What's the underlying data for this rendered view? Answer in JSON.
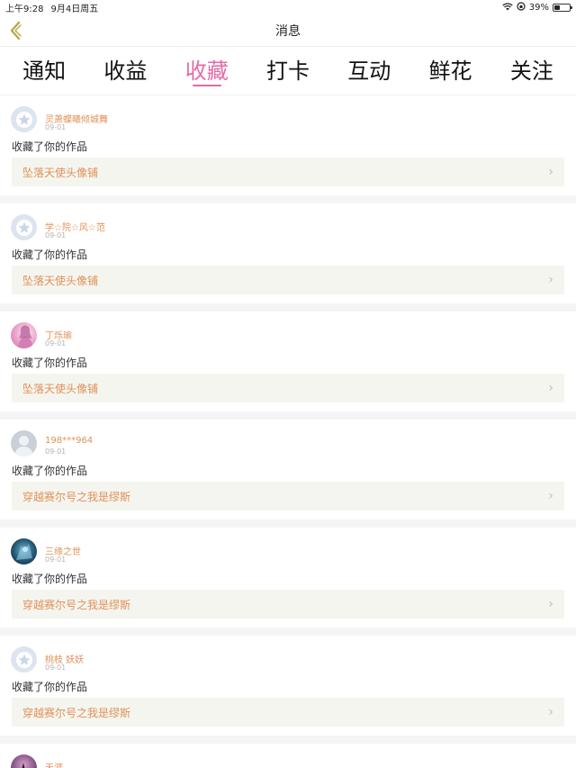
{
  "status_bar": {
    "time": "上午9:28",
    "date": "9月4日周五",
    "battery": "39%",
    "battery_level": 0.39
  },
  "nav": {
    "title": "消息"
  },
  "tabs": [
    {
      "label": "通知"
    },
    {
      "label": "收益"
    },
    {
      "label": "收藏"
    },
    {
      "label": "打卡"
    },
    {
      "label": "互动"
    },
    {
      "label": "鲜花"
    },
    {
      "label": "关注"
    }
  ],
  "active_tab": "收藏",
  "colors": {
    "accent": "#e36aa8",
    "name": "#e0915a",
    "work_bg": "#f5f5ef"
  },
  "items": [
    {
      "name": "灵萧蝶曦倾城舞",
      "date": "09-01",
      "action": "收藏了你的作品",
      "work": "坠落天使头像铺",
      "avatar": "default-star-icon"
    },
    {
      "name": "学☆院☆风☆范",
      "date": "09-01",
      "action": "收藏了你的作品",
      "work": "坠落天使头像铺",
      "avatar": "default-star-icon"
    },
    {
      "name": "丁烁瑜",
      "date": "09-01",
      "action": "收藏了你的作品",
      "work": "坠落天使头像铺",
      "avatar": "photo"
    },
    {
      "name": "198***964",
      "date": "09-01",
      "action": "收藏了你的作品",
      "work": "穿越赛尔号之我是缪斯",
      "avatar": "default-person-icon"
    },
    {
      "name": "三缘之世",
      "date": "09-01",
      "action": "收藏了你的作品",
      "work": "穿越赛尔号之我是缪斯",
      "avatar": "photo"
    },
    {
      "name": "桃枝 妖妖",
      "date": "09-01",
      "action": "收藏了你的作品",
      "work": "穿越赛尔号之我是缪斯",
      "avatar": "default-star-icon"
    },
    {
      "name": "天涯",
      "avatar": "photo"
    }
  ]
}
